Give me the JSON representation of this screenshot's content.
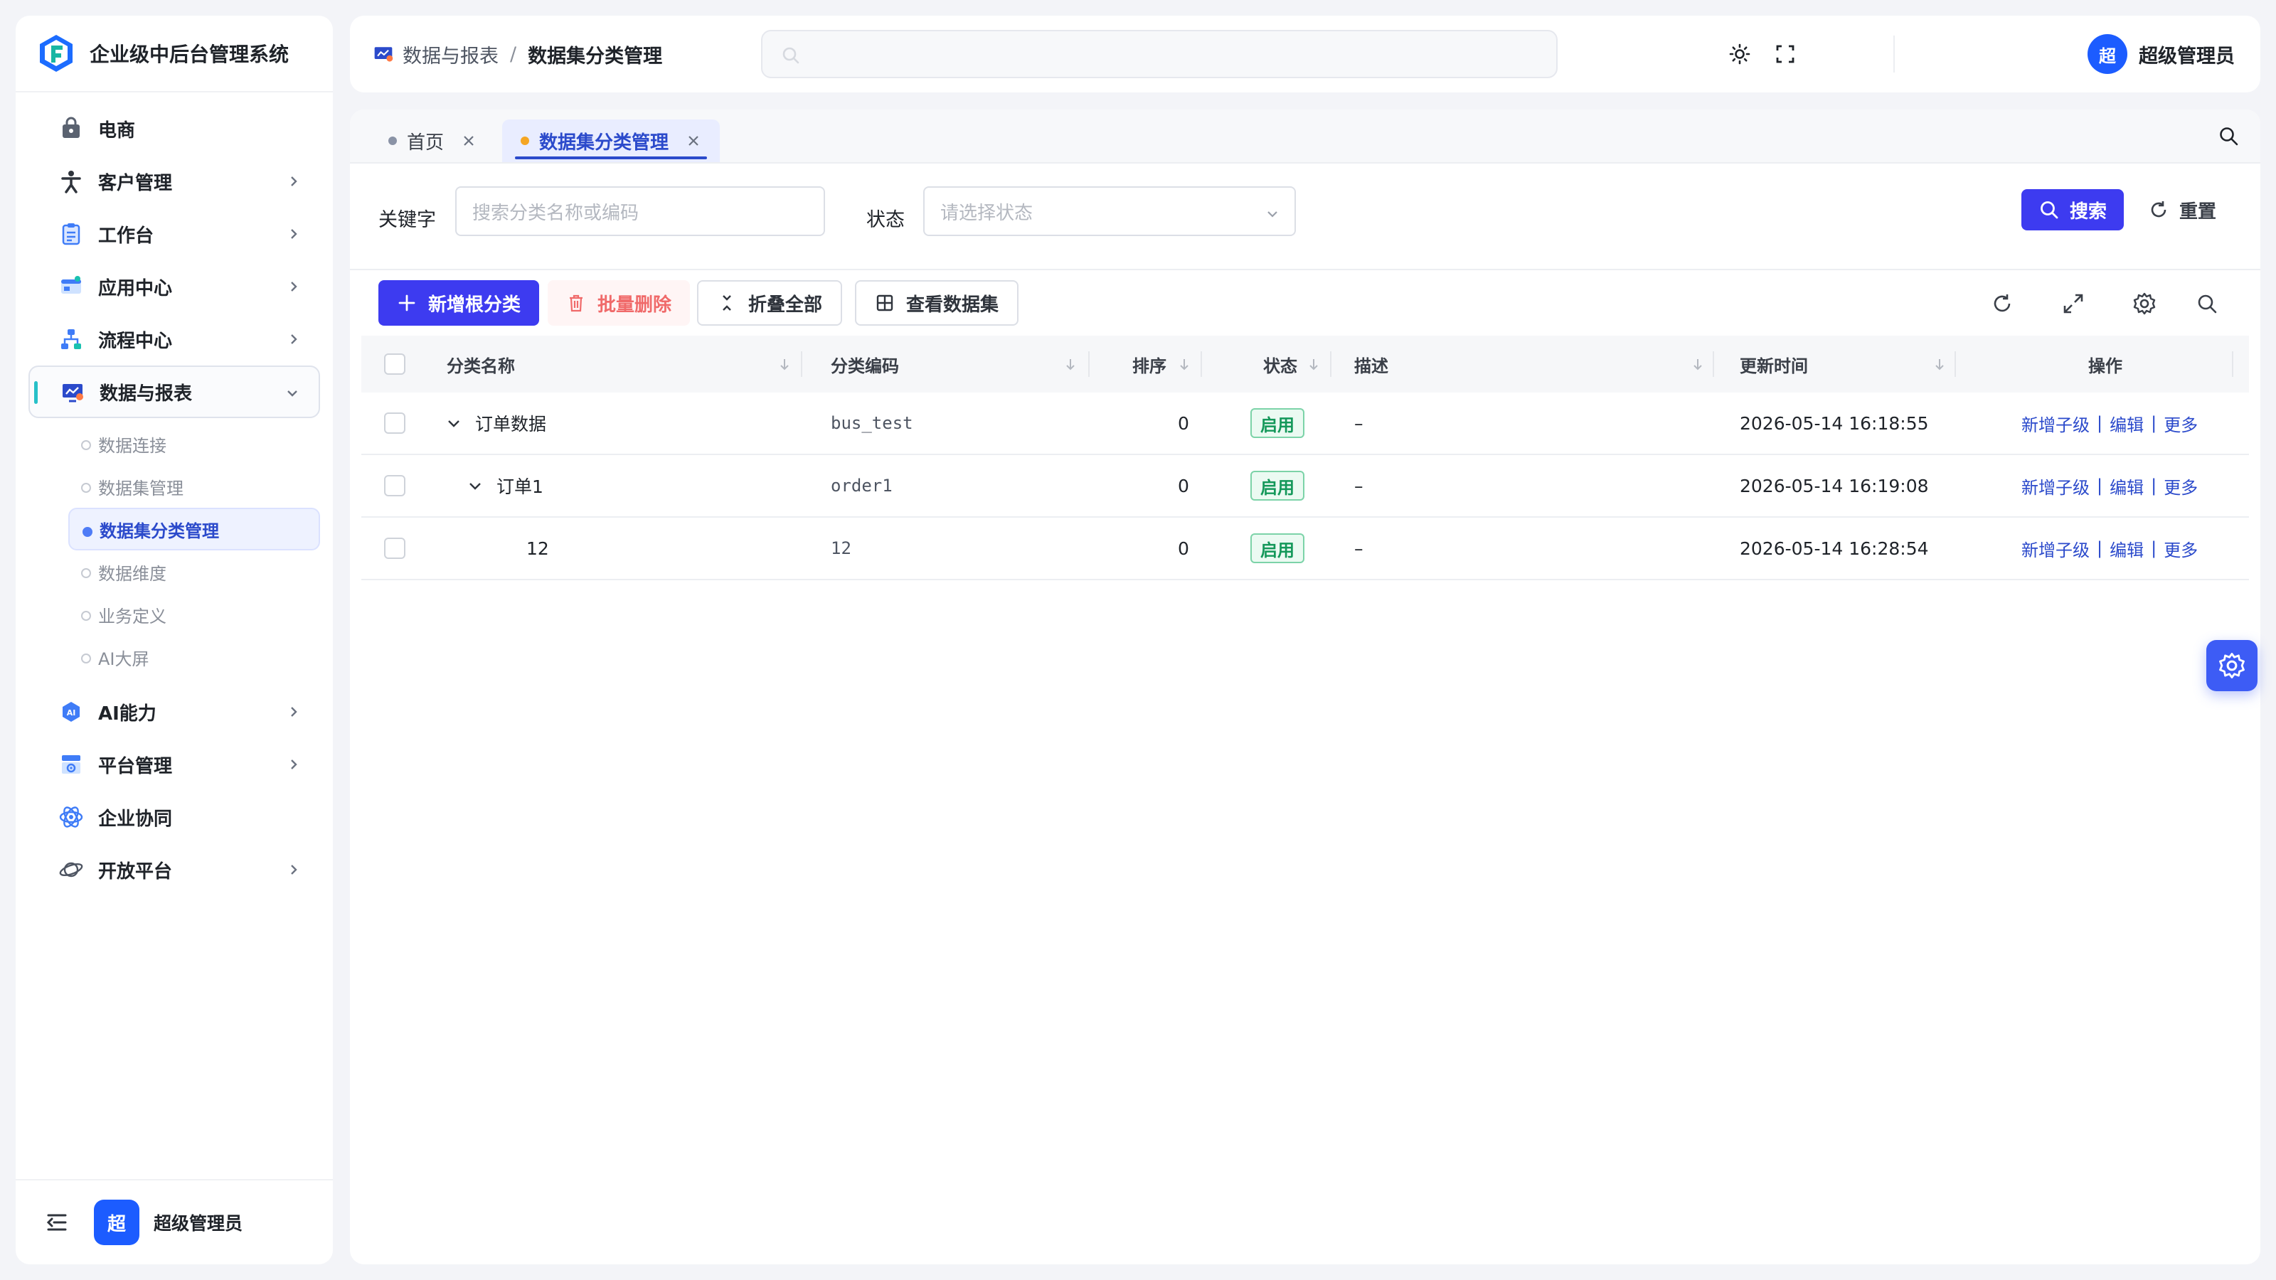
{
  "app": {
    "title": "企业级中后台管理系统"
  },
  "sidebar": {
    "items": [
      {
        "label": "电商",
        "icon": "shopping-bag-icon",
        "chevron": false
      },
      {
        "label": "客户管理",
        "icon": "person-icon",
        "chevron": true
      },
      {
        "label": "工作台",
        "icon": "clipboard-icon",
        "chevron": true
      },
      {
        "label": "应用中心",
        "icon": "app-window-icon",
        "chevron": true
      },
      {
        "label": "流程中心",
        "icon": "flowchart-icon",
        "chevron": true
      },
      {
        "label": "数据与报表",
        "icon": "report-screen-icon",
        "chevron": true,
        "open": true
      }
    ],
    "submenu": [
      {
        "label": "数据连接"
      },
      {
        "label": "数据集管理"
      },
      {
        "label": "数据集分类管理",
        "active": true
      },
      {
        "label": "数据维度"
      },
      {
        "label": "业务定义"
      },
      {
        "label": "AI大屏"
      }
    ],
    "items_after": [
      {
        "label": "AI能力",
        "icon": "ai-badge-icon",
        "chevron": true
      },
      {
        "label": "平台管理",
        "icon": "platform-icon",
        "chevron": true
      },
      {
        "label": "企业协同",
        "icon": "atom-icon",
        "chevron": false
      },
      {
        "label": "开放平台",
        "icon": "planet-icon",
        "chevron": true
      }
    ],
    "footer": {
      "avatar_text": "超",
      "user_name": "超级管理员"
    }
  },
  "header": {
    "breadcrumb_parent": "数据与报表",
    "breadcrumb_sep": "/",
    "breadcrumb_current": "数据集分类管理",
    "user_avatar_text": "超",
    "user_name": "超级管理员"
  },
  "tabs": [
    {
      "label": "首页",
      "dot_color": "#8a93a6"
    },
    {
      "label": "数据集分类管理",
      "dot_color": "#f5a623",
      "active": true
    }
  ],
  "filters": {
    "keyword_label": "关键字",
    "keyword_placeholder": "搜索分类名称或编码",
    "status_label": "状态",
    "status_placeholder": "请选择状态",
    "search_button": "搜索",
    "reset_button": "重置"
  },
  "toolbar": {
    "add_root": "新增根分类",
    "batch_delete": "批量删除",
    "collapse_all": "折叠全部",
    "view_datasets": "查看数据集"
  },
  "table": {
    "columns": [
      "分类名称",
      "分类编码",
      "排序",
      "状态",
      "描述",
      "更新时间",
      "操作"
    ],
    "rows": [
      {
        "name": "订单数据",
        "code": "bus_test",
        "sort": "0",
        "status": "启用",
        "desc": "–",
        "updated": "2026-05-14 16:18:55",
        "level": 0,
        "expandable": true
      },
      {
        "name": "订单1",
        "code": "order1",
        "sort": "0",
        "status": "启用",
        "desc": "–",
        "updated": "2026-05-14 16:19:08",
        "level": 1,
        "expandable": true
      },
      {
        "name": "12",
        "code": "12",
        "sort": "0",
        "status": "启用",
        "desc": "–",
        "updated": "2026-05-14 16:28:54",
        "level": 2,
        "expandable": false
      }
    ],
    "actions": {
      "add_child": "新增子级",
      "edit": "编辑",
      "more": "更多",
      "sep": "|"
    }
  },
  "colors": {
    "primary": "#3d3bf0",
    "link": "#2b4acb",
    "success": "#14985a",
    "danger": "#f06a6a"
  }
}
